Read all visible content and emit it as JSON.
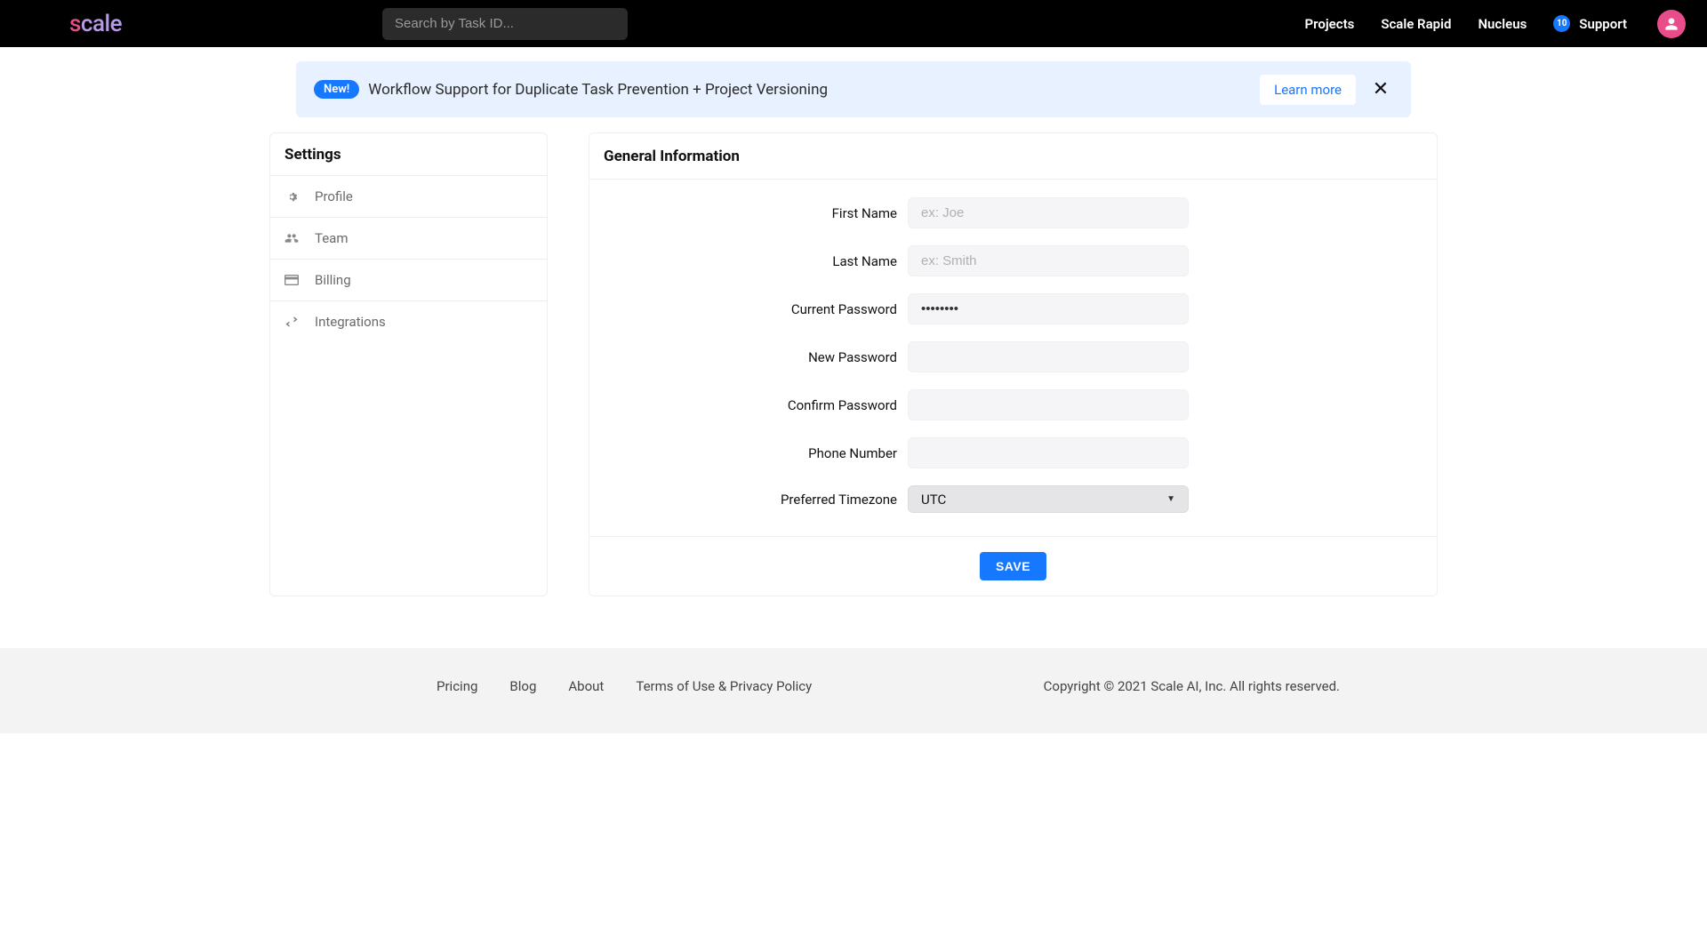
{
  "header": {
    "search_placeholder": "Search by Task ID...",
    "nav": {
      "projects": "Projects",
      "scale_rapid": "Scale Rapid",
      "nucleus": "Nucleus",
      "support": "Support",
      "support_badge": "10"
    }
  },
  "banner": {
    "badge": "New!",
    "text": "Workflow Support for Duplicate Task Prevention + Project Versioning",
    "learn_more": "Learn more"
  },
  "sidebar": {
    "title": "Settings",
    "items": [
      {
        "label": "Profile"
      },
      {
        "label": "Team"
      },
      {
        "label": "Billing"
      },
      {
        "label": "Integrations"
      }
    ]
  },
  "main": {
    "title": "General Information",
    "fields": {
      "first_name_label": "First Name",
      "first_name_placeholder": "ex: Joe",
      "last_name_label": "Last Name",
      "last_name_placeholder": "ex: Smith",
      "current_password_label": "Current Password",
      "current_password_value": "••••••••",
      "new_password_label": "New Password",
      "confirm_password_label": "Confirm Password",
      "phone_label": "Phone Number",
      "timezone_label": "Preferred Timezone",
      "timezone_value": "UTC"
    },
    "save_label": "SAVE"
  },
  "footer": {
    "links": {
      "pricing": "Pricing",
      "blog": "Blog",
      "about": "About",
      "terms": "Terms of Use & Privacy Policy"
    },
    "copyright": "Copyright © 2021 Scale AI, Inc. All rights reserved."
  }
}
